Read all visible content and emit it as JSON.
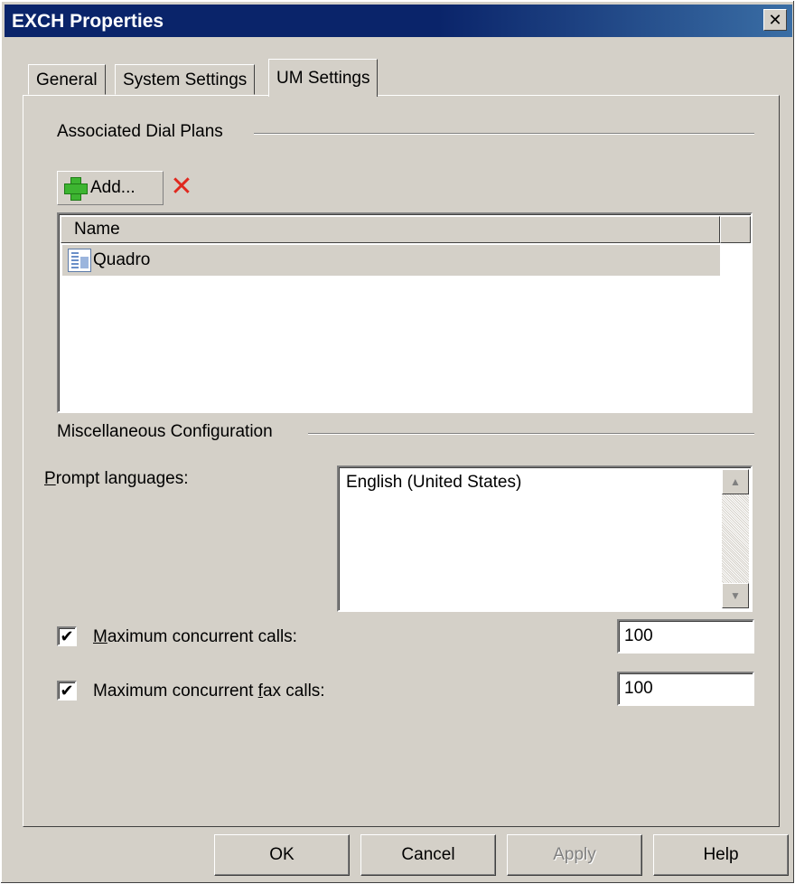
{
  "window": {
    "title": "EXCH Properties",
    "close_glyph": "✕"
  },
  "tabs": [
    {
      "label": "General",
      "active": false
    },
    {
      "label": "System Settings",
      "active": false
    },
    {
      "label": "UM Settings",
      "active": true
    }
  ],
  "dial_plans": {
    "section_label": "Associated Dial Plans",
    "add_label": "Add...",
    "delete_glyph": "✕",
    "column_header": "Name",
    "items": [
      {
        "name": "Quadro",
        "icon": "dial-plan-icon",
        "selected": true
      }
    ]
  },
  "misc": {
    "section_label": "Miscellaneous Configuration",
    "prompt_languages_label": "Prompt languages:",
    "languages": [
      "English (United States)"
    ],
    "max_calls_label": "Maximum concurrent calls:",
    "max_calls_checked": true,
    "max_calls_value": "100",
    "max_fax_label": "Maximum concurrent fax calls:",
    "max_fax_checked": true,
    "max_fax_value": "100",
    "check_glyph": "✔"
  },
  "buttons": {
    "ok": "OK",
    "cancel": "Cancel",
    "apply": "Apply",
    "help": "Help"
  },
  "colors": {
    "titlebar": "#0a246a",
    "face": "#d4d0c8",
    "add_icon": "#3db531",
    "delete_icon": "#e0281e"
  }
}
